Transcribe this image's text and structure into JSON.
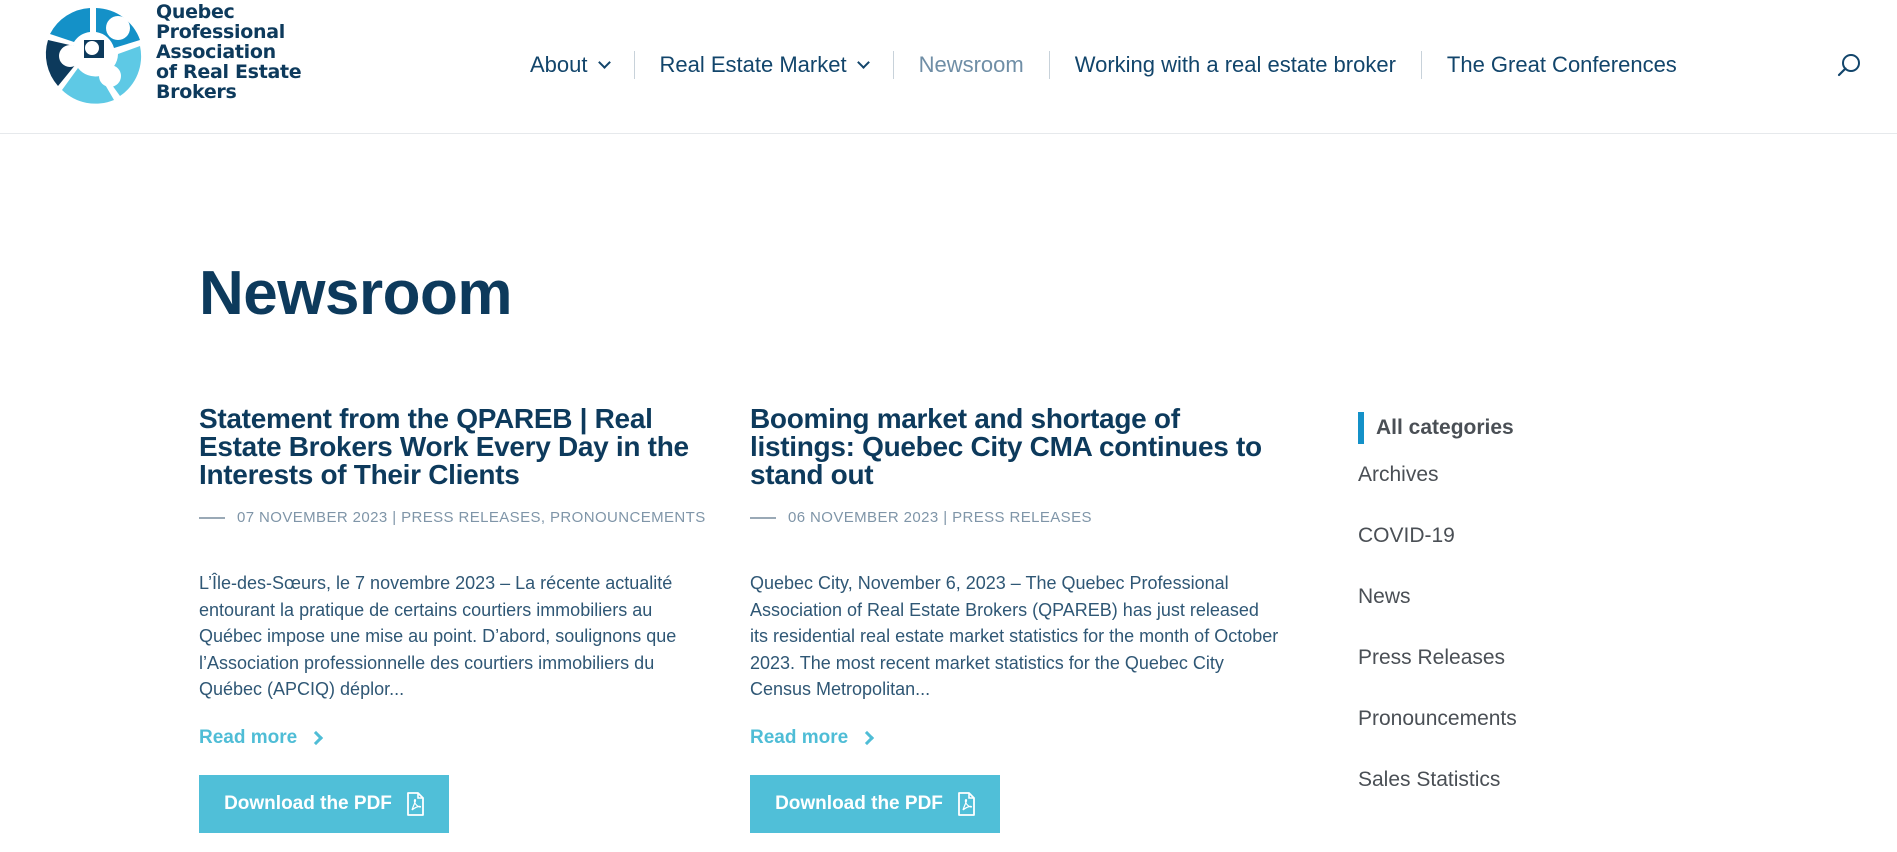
{
  "logo": {
    "line1": "Quebec",
    "line2": "Professional",
    "line3": "Association",
    "line4": "of Real Estate",
    "line5": "Brokers",
    "colors": [
      "#0d3a5c",
      "#1491c8",
      "#5ec9e5"
    ]
  },
  "nav": {
    "items": [
      {
        "label": "About",
        "has_dropdown": true
      },
      {
        "label": "Real Estate Market",
        "has_dropdown": true
      },
      {
        "label": "Newsroom",
        "active": true
      },
      {
        "label": "Working with a real estate broker"
      },
      {
        "label": "The Great Conferences"
      }
    ],
    "search_icon": "search-icon"
  },
  "page": {
    "title": "Newsroom"
  },
  "articles": [
    {
      "title": "Statement from the QPAREB | Real Estate Brokers Work Every Day in the Interests of Their Clients",
      "meta": "07 NOVEMBER 2023 | PRESS RELEASES, PRONOUNCEMENTS",
      "excerpt": "L’Île-des-Sœurs, le 7 novembre 2023 – La récente actualité entourant la pratique de certains courtiers immobiliers au Québec impose une mise au point. D’abord, soulignons que l’Association professionnelle des courtiers immobiliers du Québec (APCIQ) déplor...",
      "read_more": "Read more",
      "pdf_label": "Download the PDF"
    },
    {
      "title": "Booming market and shortage of listings: Quebec City CMA continues to stand out",
      "meta": "06 NOVEMBER 2023 | PRESS RELEASES",
      "excerpt": "Quebec City, November 6, 2023 – The Quebec Professional Association of Real Estate Brokers (QPAREB) has just released its residential real estate market statistics for the month of October 2023. The most recent market statistics for the Quebec City Census Metropolitan...",
      "read_more": "Read more",
      "pdf_label": "Download the PDF"
    }
  ],
  "sidebar": {
    "categories": [
      {
        "label": "All categories",
        "active": true
      },
      {
        "label": "Archives"
      },
      {
        "label": "COVID-19"
      },
      {
        "label": "News"
      },
      {
        "label": "Press Releases"
      },
      {
        "label": "Pronouncements"
      },
      {
        "label": "Sales Statistics"
      }
    ]
  },
  "colors": {
    "primary": "#0d3a5c",
    "accent": "#50bfd8",
    "active_bar": "#1491c8",
    "muted": "#7f95a8"
  }
}
